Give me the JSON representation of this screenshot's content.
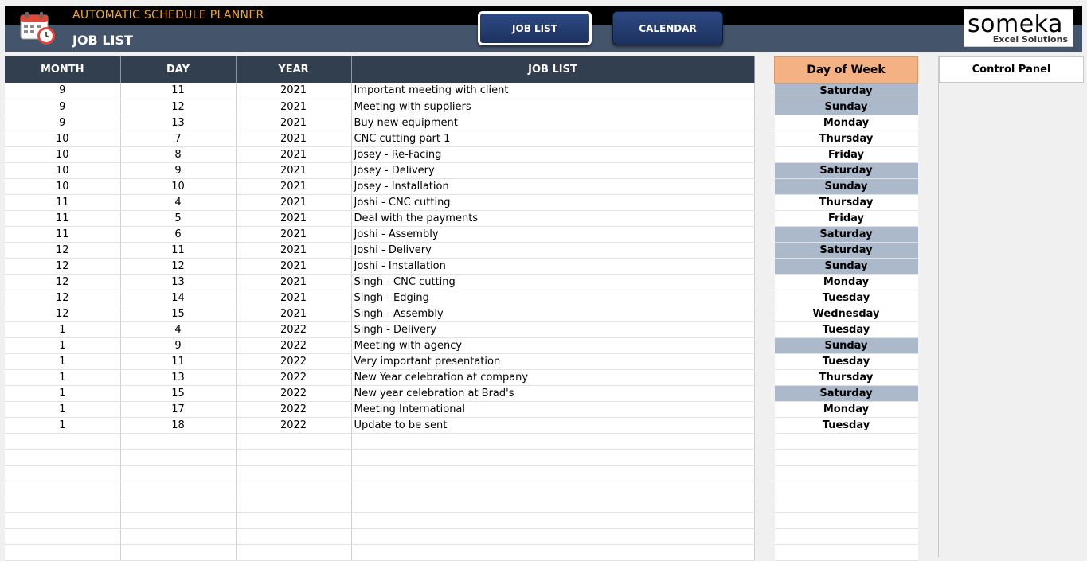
{
  "app": {
    "title": "AUTOMATIC SCHEDULE PLANNER",
    "page_title": "JOB LIST"
  },
  "nav": {
    "job_list": "JOB LIST",
    "calendar": "CALENDAR"
  },
  "logo": {
    "word": "someka",
    "tagline": "Excel Solutions"
  },
  "colors": {
    "header_dark": "#323f4f",
    "accent_orange": "#f5a623",
    "weekend_fill": "#acb9ca",
    "dow_header": "#f4b183"
  },
  "table": {
    "columns": [
      "MONTH",
      "DAY",
      "YEAR",
      "JOB LIST"
    ],
    "rows": [
      [
        "9",
        "11",
        "2021",
        "Important meeting with client"
      ],
      [
        "9",
        "12",
        "2021",
        "Meeting with suppliers"
      ],
      [
        "9",
        "13",
        "2021",
        "Buy new equipment"
      ],
      [
        "10",
        "7",
        "2021",
        "CNC cutting part 1"
      ],
      [
        "10",
        "8",
        "2021",
        "Josey - Re-Facing"
      ],
      [
        "10",
        "9",
        "2021",
        "Josey - Delivery"
      ],
      [
        "10",
        "10",
        "2021",
        "Josey - Installation"
      ],
      [
        "11",
        "4",
        "2021",
        "Joshi - CNC cutting"
      ],
      [
        "11",
        "5",
        "2021",
        "Deal with the payments"
      ],
      [
        "11",
        "6",
        "2021",
        "Joshi - Assembly"
      ],
      [
        "12",
        "11",
        "2021",
        "Joshi - Delivery"
      ],
      [
        "12",
        "12",
        "2021",
        "Joshi - Installation"
      ],
      [
        "12",
        "13",
        "2021",
        "Singh - CNC cutting"
      ],
      [
        "12",
        "14",
        "2021",
        "Singh - Edging"
      ],
      [
        "12",
        "15",
        "2021",
        "Singh - Assembly"
      ],
      [
        "1",
        "4",
        "2022",
        "Singh - Delivery"
      ],
      [
        "1",
        "9",
        "2022",
        "Meeting with agency"
      ],
      [
        "1",
        "11",
        "2022",
        "Very important presentation"
      ],
      [
        "1",
        "13",
        "2022",
        "New Year celebration at company"
      ],
      [
        "1",
        "15",
        "2022",
        "New year celebration at Brad's"
      ],
      [
        "1",
        "17",
        "2022",
        "Meeting International"
      ],
      [
        "1",
        "18",
        "2022",
        "Update to be sent"
      ]
    ]
  },
  "day_of_week": {
    "header": "Day of Week",
    "values": [
      "Saturday",
      "Sunday",
      "Monday",
      "Thursday",
      "Friday",
      "Saturday",
      "Sunday",
      "Thursday",
      "Friday",
      "Saturday",
      "Saturday",
      "Sunday",
      "Monday",
      "Tuesday",
      "Wednesday",
      "Tuesday",
      "Sunday",
      "Tuesday",
      "Thursday",
      "Saturday",
      "Monday",
      "Tuesday"
    ]
  },
  "control_panel": {
    "title": "Control Panel"
  }
}
